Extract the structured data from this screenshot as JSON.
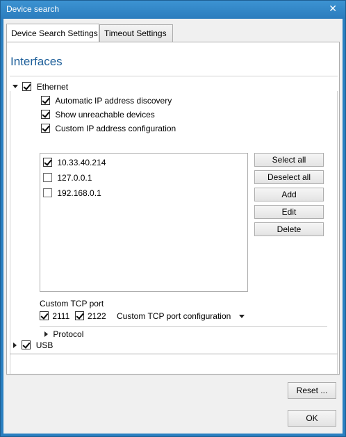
{
  "window": {
    "title": "Device search"
  },
  "tabs": [
    {
      "label": "Device Search Settings"
    },
    {
      "label": "Timeout Settings"
    }
  ],
  "interfaces": {
    "title": "Interfaces",
    "ethernet": {
      "label": "Ethernet",
      "checked": true,
      "options": [
        {
          "label": "Automatic IP address discovery",
          "checked": true
        },
        {
          "label": "Show unreachable devices",
          "checked": true
        },
        {
          "label": "Custom IP address configuration",
          "checked": true
        }
      ],
      "ip_list": [
        {
          "address": "10.33.40.214",
          "checked": true
        },
        {
          "address": "127.0.0.1",
          "checked": false
        },
        {
          "address": "192.168.0.1",
          "checked": false
        }
      ],
      "buttons": {
        "select_all": "Select all",
        "deselect_all": "Deselect all",
        "add": "Add",
        "edit": "Edit",
        "delete": "Delete"
      },
      "tcp": {
        "label": "Custom TCP port",
        "ports": [
          {
            "value": "2111",
            "checked": true
          },
          {
            "value": "2122",
            "checked": true
          }
        ],
        "config_label": "Custom TCP port configuration"
      },
      "protocol_label": "Protocol"
    },
    "usb": {
      "label": "USB",
      "checked": true
    }
  },
  "footer": {
    "reset": "Reset ...",
    "ok": "OK"
  }
}
